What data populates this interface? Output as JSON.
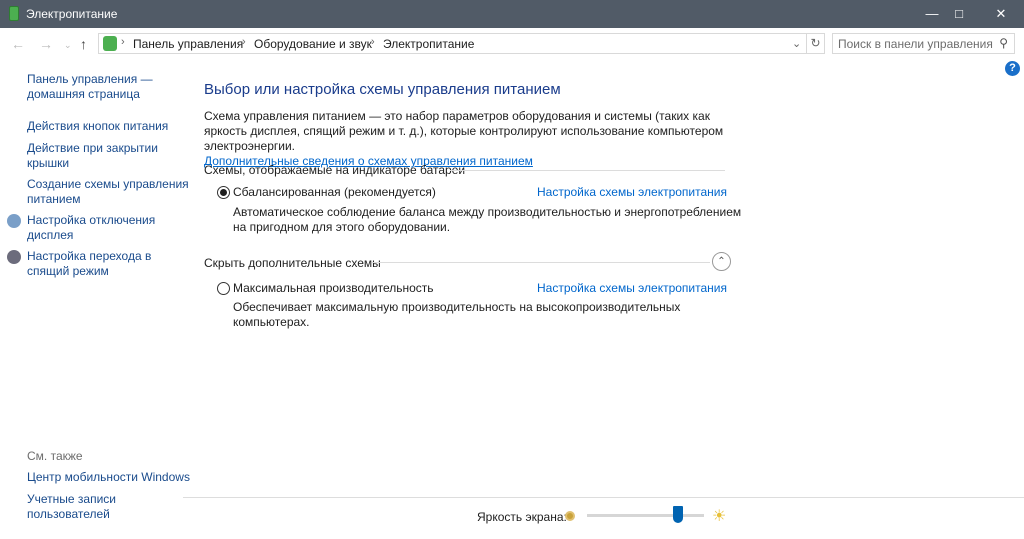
{
  "window": {
    "title": "Электропитание",
    "icon": "battery-icon"
  },
  "address": {
    "crumbs": [
      "Панель управления",
      "Оборудование и звук",
      "Электропитание"
    ],
    "search_placeholder": "Поиск в панели управления"
  },
  "sidebar": {
    "items": [
      {
        "label": "Панель управления — домашняя страница",
        "lines": [
          "Панель управления —",
          "домашняя страница"
        ]
      },
      {
        "lines": [
          "Действия кнопок питания"
        ]
      },
      {
        "lines": [
          "Действие при закрытии",
          "крышки"
        ]
      },
      {
        "lines": [
          "Создание схемы управления",
          "питанием"
        ]
      },
      {
        "lines": [
          "Настройка отключения",
          "дисплея"
        ]
      },
      {
        "lines": [
          "Настройка перехода в",
          "спящий режим"
        ]
      }
    ],
    "see_also": "См. также",
    "see_also_items": [
      {
        "lines": [
          "Центр мобильности Windows"
        ]
      },
      {
        "lines": [
          "Учетные записи",
          "пользователей"
        ]
      }
    ]
  },
  "main": {
    "title": "Выбор или настройка схемы управления питанием",
    "desc1": "Схема управления питанием — это набор параметров оборудования и системы (таких как яркость дисплея, спящий режим и т. д.), которые контролируют использование компьютером электроэнергии.",
    "more_link": "Дополнительные сведения о схемах управления питанием",
    "group1": "Схемы, отображаемые на индикаторе батареи",
    "group2": "Скрыть дополнительные схемы",
    "plans": [
      {
        "name": "Сбалансированная (рекомендуется)",
        "selected": true,
        "link": "Настройка схемы электропитания",
        "desc": [
          "Автоматическое соблюдение баланса между производительностью и энергопотреблением",
          "на пригодном для этого оборудовании."
        ]
      },
      {
        "name": "Максимальная производительность",
        "selected": false,
        "link": "Настройка схемы электропитания",
        "desc": [
          "Обеспечивает максимальную производительность на высокопроизводительных",
          "компьютерах."
        ]
      }
    ]
  },
  "brightness": {
    "label": "Яркость экрана:",
    "value_percent": 78
  }
}
